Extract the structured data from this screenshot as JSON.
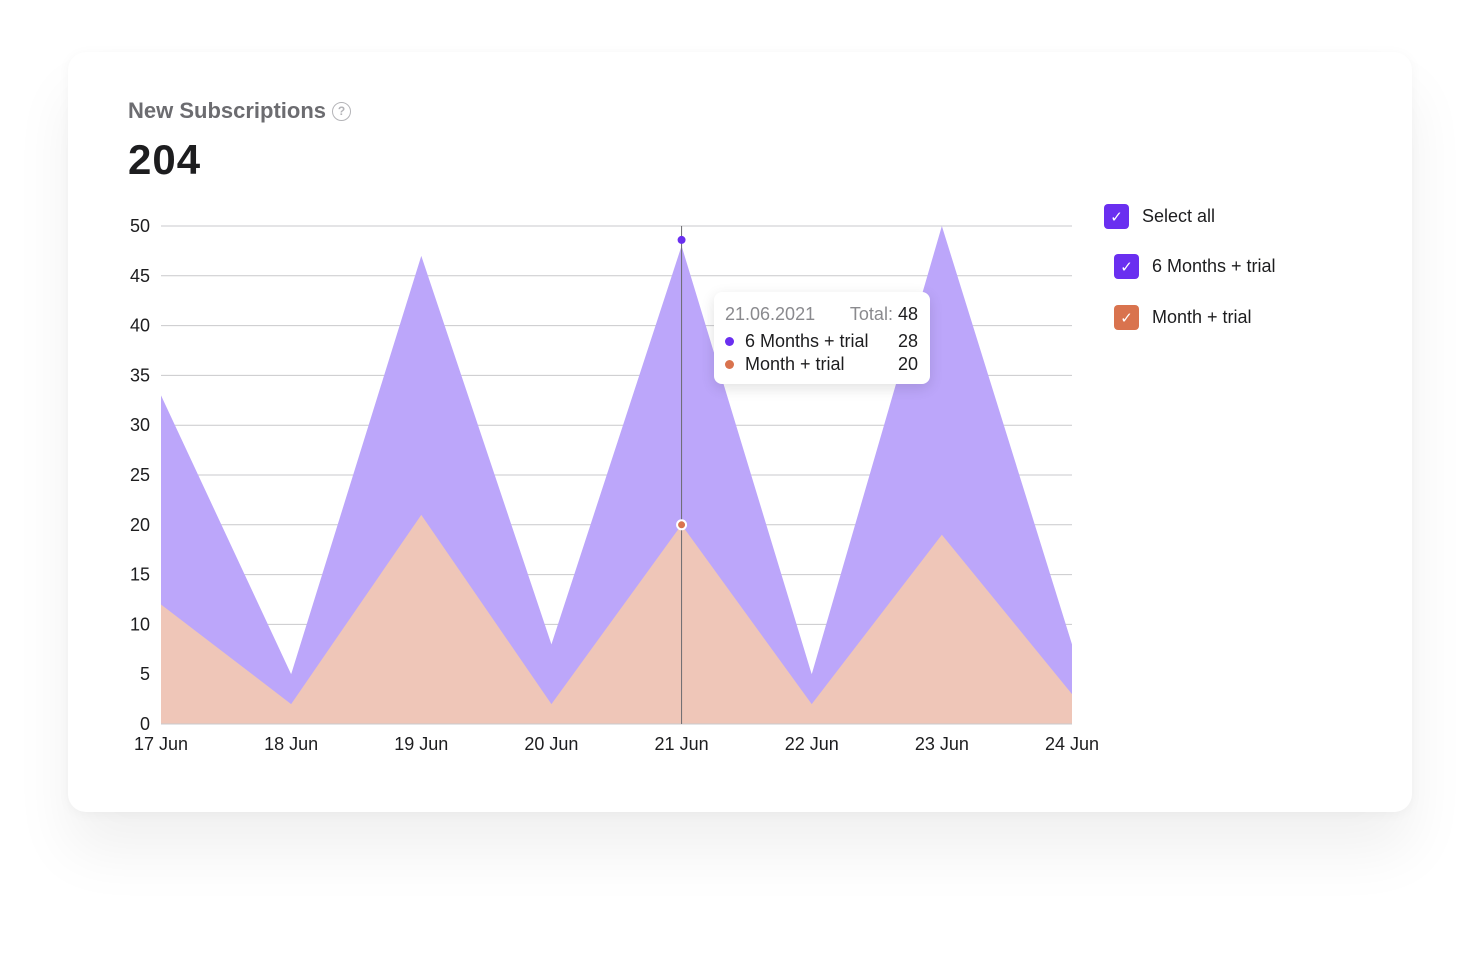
{
  "card": {
    "title": "New Subscriptions",
    "help_icon": "question-circle-icon",
    "total": "204"
  },
  "colors": {
    "six_months": "#6a2ff0",
    "six_months_area": "#bca6fa",
    "month": "#d9734e",
    "month_area": "#efc6b8"
  },
  "chart_data": {
    "type": "area",
    "stacked": true,
    "categories": [
      "17 Jun",
      "18 Jun",
      "19 Jun",
      "20 Jun",
      "21 Jun",
      "22 Jun",
      "23 Jun",
      "24 Jun"
    ],
    "series": [
      {
        "name": "Month + trial",
        "values": [
          12,
          2,
          21,
          2,
          20,
          2,
          19,
          3
        ]
      },
      {
        "name": "6 Months + trial",
        "values": [
          21,
          3,
          26,
          6,
          28,
          3,
          31,
          5
        ]
      }
    ],
    "ylim": [
      0,
      50
    ],
    "yticks": [
      0,
      5,
      10,
      15,
      20,
      25,
      30,
      35,
      40,
      45,
      50
    ],
    "grid": true,
    "highlighted_index": 4
  },
  "tooltip": {
    "date": "21.06.2021",
    "total_label": "Total:",
    "total_value": "48",
    "rows": [
      {
        "name": "6 Months + trial",
        "value": "28"
      },
      {
        "name": "Month + trial",
        "value": "20"
      }
    ]
  },
  "legend": {
    "select_all": {
      "label": "Select all",
      "checked": true
    },
    "items": [
      {
        "label": "6 Months + trial",
        "checked": true
      },
      {
        "label": "Month + trial",
        "checked": true
      }
    ],
    "check_icon": "checkmark-icon"
  }
}
